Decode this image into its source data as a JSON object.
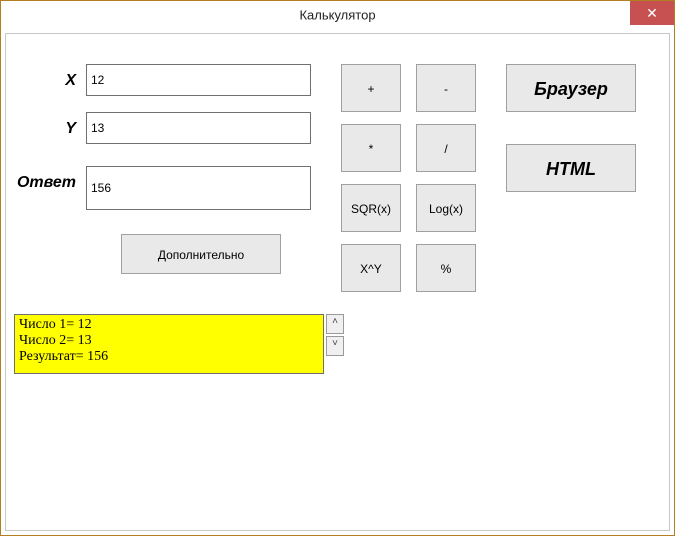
{
  "window": {
    "title": "Калькулятор",
    "close_glyph": "✕"
  },
  "labels": {
    "x": "X",
    "y": "Y",
    "answer": "Ответ"
  },
  "inputs": {
    "x": "12",
    "y": "13",
    "answer": "156"
  },
  "ops": {
    "plus": "+",
    "minus": "-",
    "mult": "*",
    "div": "/",
    "sqr": "SQR(x)",
    "log": "Log(x)",
    "pow": "X^Y",
    "mod": "%"
  },
  "side": {
    "browser": "Браузер",
    "html": "HTML"
  },
  "extra": {
    "more": "Дополнительно"
  },
  "log": {
    "lines": "Число 1= 12\nЧисло 2= 13\nРезультат= 156"
  },
  "scroll": {
    "up": "˄",
    "down": "˅"
  }
}
